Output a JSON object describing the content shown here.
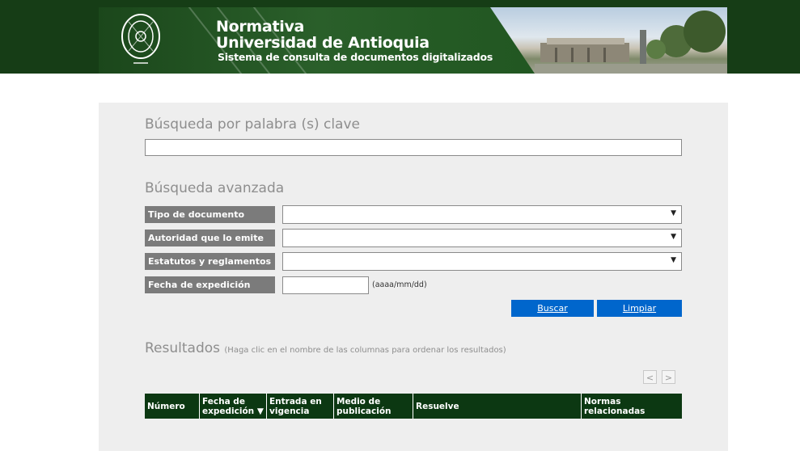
{
  "header": {
    "title_line1": "Normativa",
    "title_line2": "Universidad de Antioquia",
    "subtitle": "Sistema de consulta de documentos digitalizados"
  },
  "keyword_search": {
    "title": "Búsqueda por palabra (s) clave",
    "value": ""
  },
  "advanced_search": {
    "title": "Búsqueda avanzada",
    "fields": [
      {
        "label": "Tipo de documento",
        "value": ""
      },
      {
        "label": "Autoridad que lo emite",
        "value": ""
      },
      {
        "label": "Estatutos y reglamentos",
        "value": ""
      }
    ],
    "date_label": "Fecha de expedición",
    "date_value": "",
    "date_hint": "(aaaa/mm/dd)",
    "search_button": "Buscar",
    "clear_button": "Limpiar",
    "dropdown_arrow": "▼"
  },
  "results": {
    "title": "Resultados",
    "hint": "(Haga clic en el nombre de las columnas para ordenar los resultados)",
    "prev": "<",
    "next": ">",
    "columns": [
      "Número",
      "Fecha de expedición ▼",
      "Entrada en vigencia",
      "Medio de publicación",
      "Resuelve",
      "Normas relacionadas"
    ]
  },
  "colors": {
    "header_green": "#163d16",
    "table_head": "#0c3812",
    "button_blue": "#0066cc",
    "label_gray": "#7b7b7b",
    "panel_gray": "#eeeeee"
  }
}
